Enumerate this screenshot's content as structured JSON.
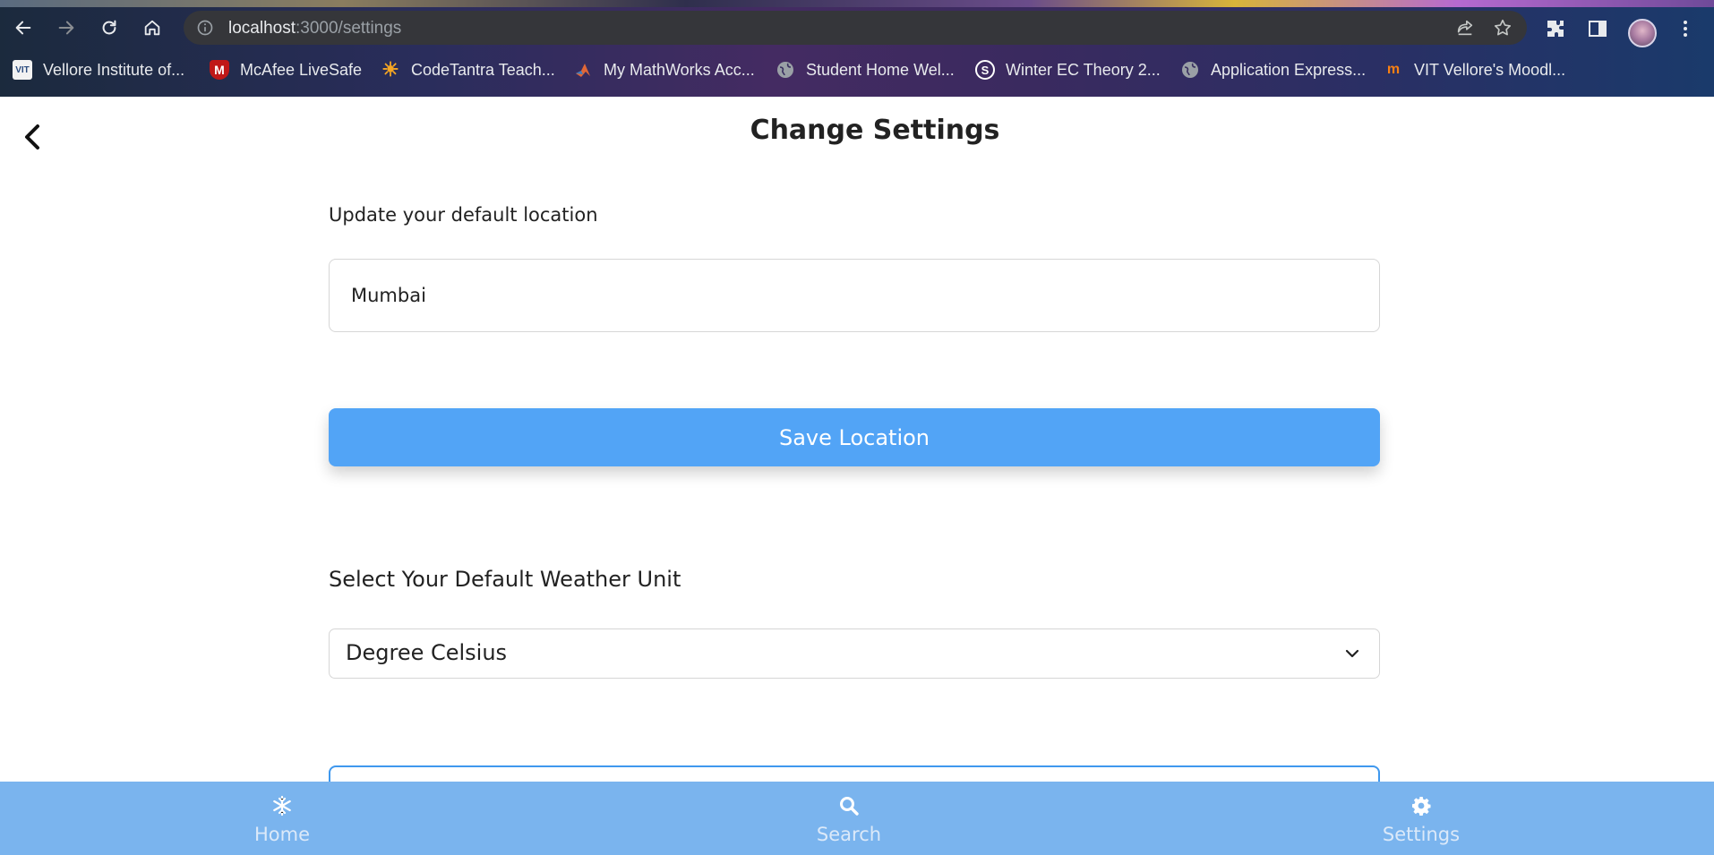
{
  "browser": {
    "url_host": "localhost",
    "url_path": ":3000/settings",
    "bookmarks": [
      {
        "label": "Vellore Institute of...",
        "icon": "vit-logo-icon",
        "color": "#ffffff"
      },
      {
        "label": "McAfee LiveSafe",
        "icon": "mcafee-shield-icon",
        "color": "#c01818"
      },
      {
        "label": "CodeTantra Teach...",
        "icon": "sun-icon",
        "color": "#f5a623"
      },
      {
        "label": "My MathWorks Acc...",
        "icon": "mathworks-icon",
        "color": "#e16737"
      },
      {
        "label": "Student Home Wel...",
        "icon": "globe-icon",
        "color": "#9aa0a6"
      },
      {
        "label": "Winter EC Theory 2...",
        "icon": "s-circle-icon",
        "color": "#ffffff"
      },
      {
        "label": "Application Express...",
        "icon": "globe-icon",
        "color": "#9aa0a6"
      },
      {
        "label": "VIT Vellore's Moodl...",
        "icon": "moodle-icon",
        "color": "#f98012"
      }
    ]
  },
  "header": {
    "title": "Change Settings"
  },
  "location": {
    "label": "Update your default location",
    "value": "Mumbai",
    "save_label": "Save Location"
  },
  "unit": {
    "label": "Select Your Default Weather Unit",
    "selected": "Degree Celsius"
  },
  "bottom_nav": {
    "items": [
      {
        "label": "Home",
        "icon": "snowflake-icon"
      },
      {
        "label": "Search",
        "icon": "search-icon"
      },
      {
        "label": "Settings",
        "icon": "gear-icon"
      }
    ]
  },
  "colors": {
    "accent": "#52a4f6",
    "bottom_nav": "#7ab4ee"
  }
}
